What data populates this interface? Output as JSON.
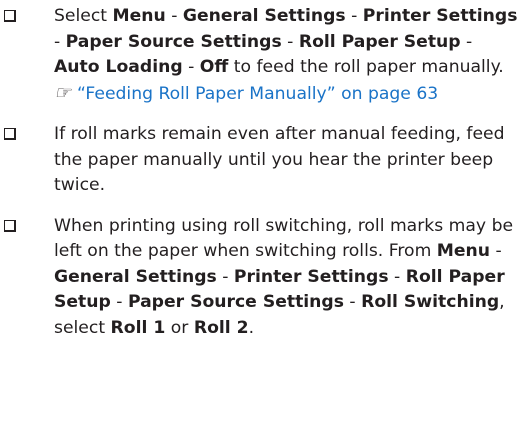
{
  "items": [
    {
      "parts": [
        {
          "t": "Select ",
          "b": false
        },
        {
          "t": "Menu",
          "b": true
        },
        {
          "t": " - ",
          "b": false
        },
        {
          "t": "General Settings",
          "b": true
        },
        {
          "t": " - ",
          "b": false
        },
        {
          "t": "Printer Settings",
          "b": true
        },
        {
          "t": " - ",
          "b": false
        },
        {
          "t": "Paper Source Settings",
          "b": true
        },
        {
          "t": " - ",
          "b": false
        },
        {
          "t": "Roll Paper Setup",
          "b": true
        },
        {
          "t": " - ",
          "b": false
        },
        {
          "t": "Auto Loading",
          "b": true
        },
        {
          "t": " - ",
          "b": false
        },
        {
          "t": "Off",
          "b": true
        },
        {
          "t": " to feed the roll paper manually.",
          "b": false
        }
      ],
      "reference": {
        "icon": "pointing-hand-icon",
        "icon_glyph": "☞",
        "text": "“Feeding Roll Paper Manually” on page 63"
      }
    },
    {
      "parts": [
        {
          "t": "If roll marks remain even after manual feeding, feed the paper manually until you hear the printer beep twice.",
          "b": false
        }
      ]
    },
    {
      "parts": [
        {
          "t": "When printing using roll switching, roll marks may be left on the paper when switching rolls. From ",
          "b": false
        },
        {
          "t": "Menu",
          "b": true
        },
        {
          "t": " - ",
          "b": false
        },
        {
          "t": "General Settings",
          "b": true
        },
        {
          "t": " - ",
          "b": false
        },
        {
          "t": "Printer Settings",
          "b": true
        },
        {
          "t": " - ",
          "b": false
        },
        {
          "t": "Roll Paper Setup",
          "b": true
        },
        {
          "t": " - ",
          "b": false
        },
        {
          "t": "Paper Source Settings",
          "b": true
        },
        {
          "t": " - ",
          "b": false
        },
        {
          "t": "Roll Switching",
          "b": true
        },
        {
          "t": ", select ",
          "b": false
        },
        {
          "t": "Roll 1",
          "b": true
        },
        {
          "t": " or ",
          "b": false
        },
        {
          "t": "Roll 2",
          "b": true
        },
        {
          "t": ".",
          "b": false
        }
      ]
    }
  ],
  "colors": {
    "text": "#231f20",
    "link": "#1a73c7"
  }
}
